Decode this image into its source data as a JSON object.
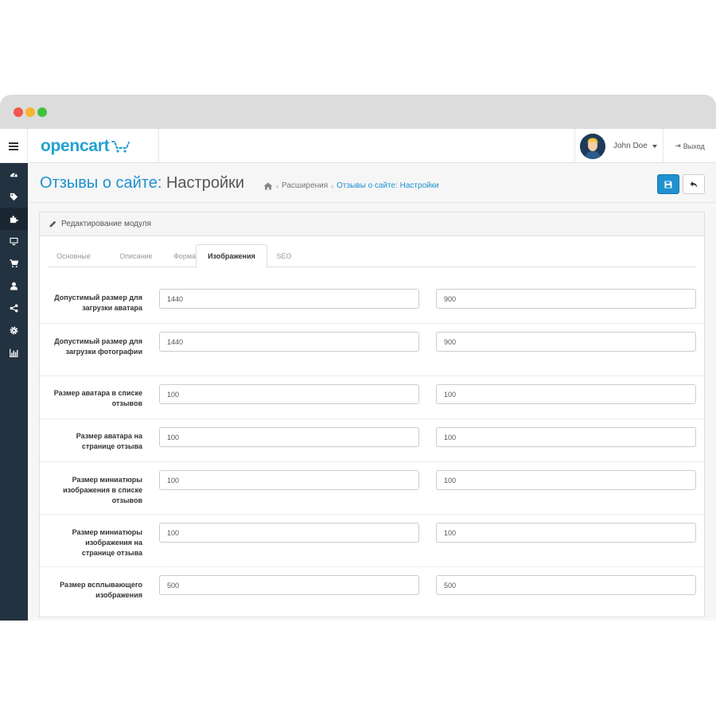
{
  "app": {
    "logo_text": "opencart",
    "user_name": "John Doe",
    "logout_label": "Выход"
  },
  "colors": {
    "accent": "#1e91cf",
    "sidebar": "#233240",
    "logo": "#23a1d1"
  },
  "sidebar": {
    "items": [
      {
        "icon": "dashboard-icon"
      },
      {
        "icon": "tags-icon"
      },
      {
        "icon": "puzzle-icon",
        "active": true
      },
      {
        "icon": "desktop-icon"
      },
      {
        "icon": "cart-icon"
      },
      {
        "icon": "user-icon"
      },
      {
        "icon": "share-icon"
      },
      {
        "icon": "cog-icon"
      },
      {
        "icon": "bar-chart-icon"
      }
    ]
  },
  "header": {
    "title_main": "Отзывы о сайте: ",
    "title_sub": "Настройки",
    "breadcrumb": {
      "extensions": "Расширения",
      "current": "Отзывы о сайте: Настройки"
    }
  },
  "panel": {
    "heading": "Редактирование модуля",
    "tabs": [
      {
        "label": "Основные"
      },
      {
        "label": "Описание"
      },
      {
        "label": "Форма"
      },
      {
        "label": "Изображения",
        "active": true
      },
      {
        "label": "SEO"
      }
    ],
    "rows": [
      {
        "label": "Допустимый размер для загрузки аватара",
        "width": "1440",
        "height": "900"
      },
      {
        "label": "Допустимый размер для загрузки фотографии",
        "width": "1440",
        "height": "900"
      },
      {
        "label": "Размер аватара в списке отзывов",
        "width": "100",
        "height": "100"
      },
      {
        "label": "Размер аватара на странице отзыва",
        "width": "100",
        "height": "100"
      },
      {
        "label": "Размер миниатюры изображения в списке отзывов",
        "width": "100",
        "height": "100"
      },
      {
        "label": "Размер миниатюры изображения на странице отзыва",
        "width": "100",
        "height": "100"
      },
      {
        "label": "Размер всплывающего изображения",
        "width": "500",
        "height": "500"
      }
    ]
  }
}
